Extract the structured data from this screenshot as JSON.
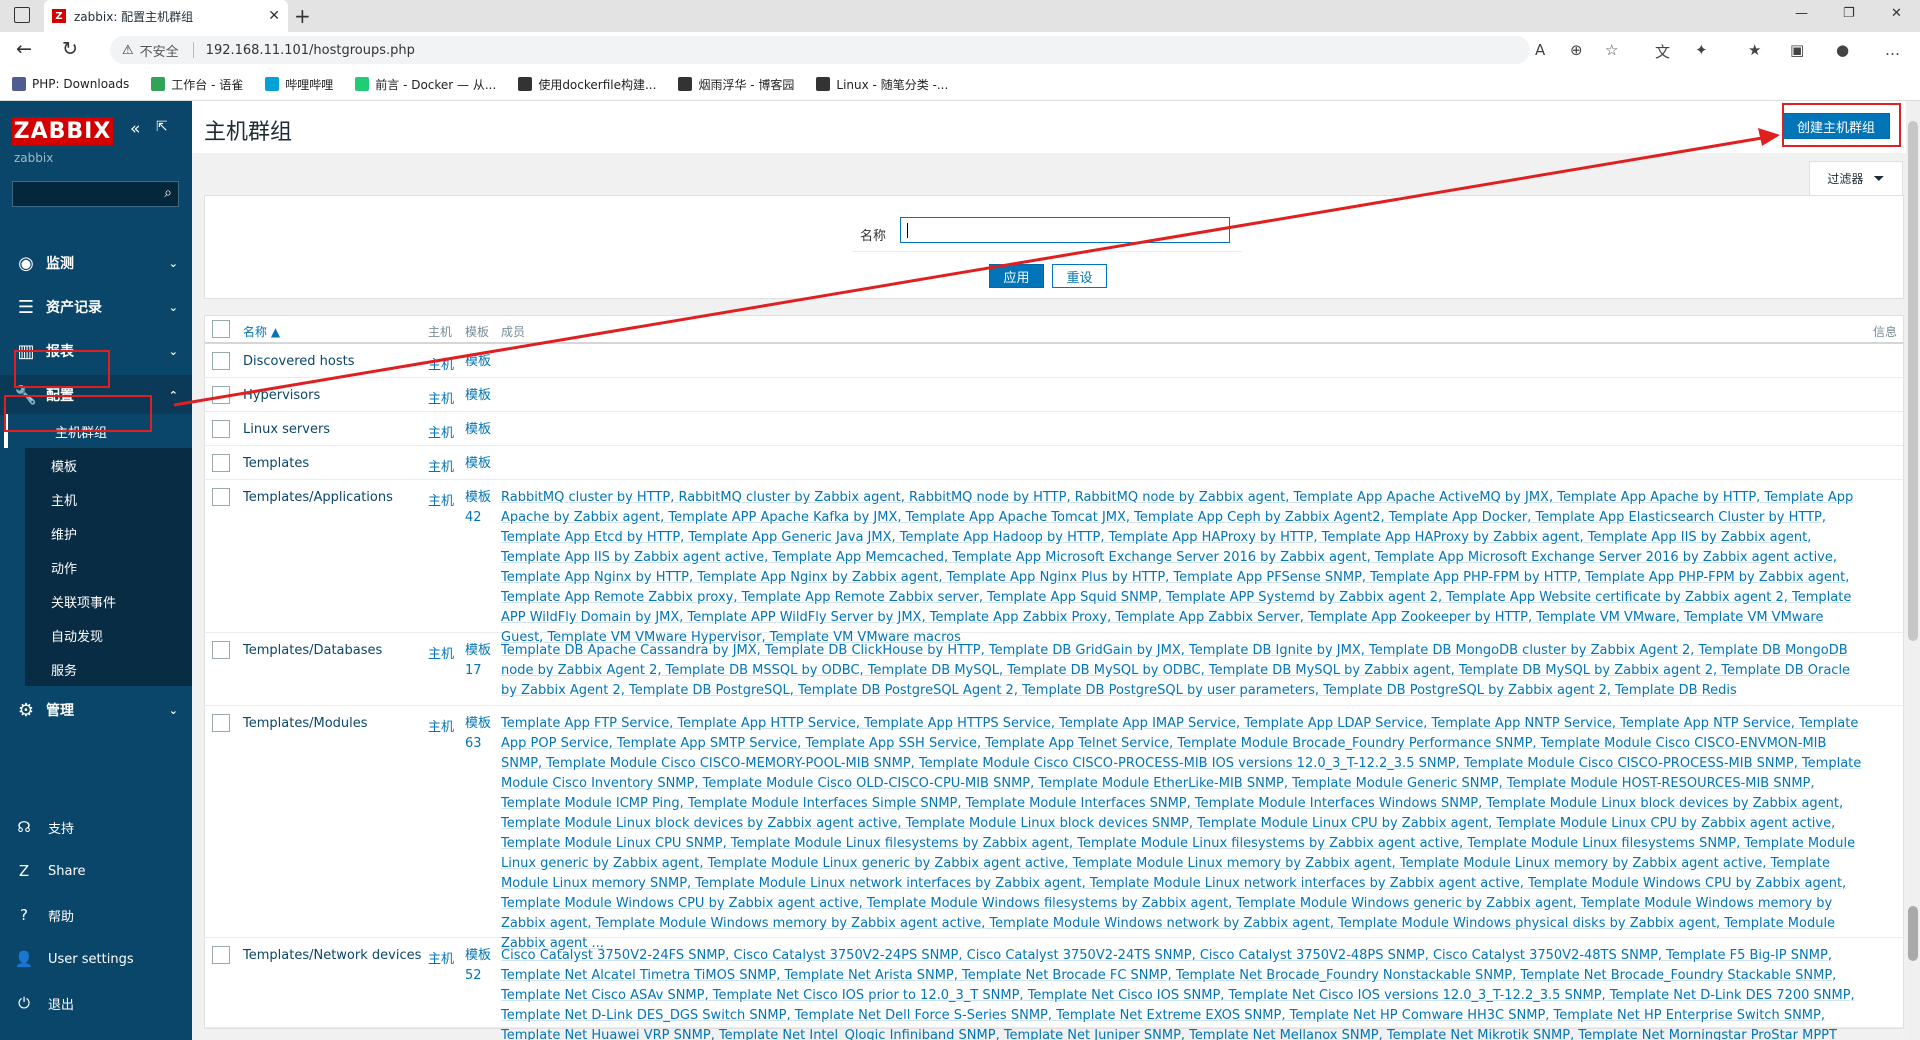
{
  "browser": {
    "tab_title": "zabbix: 配置主机群组",
    "tab_favicon": "Z",
    "url_warning": "不安全",
    "url": "192.168.11.101/hostgroups.php",
    "bookmarks": [
      {
        "label": "PHP: Downloads",
        "icon": "php",
        "color": "#4f5b93"
      },
      {
        "label": "工作台 - 语雀",
        "icon": "yuque",
        "color": "#31a354"
      },
      {
        "label": "哔哩哔哩",
        "icon": "bili",
        "color": "#00a1d6"
      },
      {
        "label": "前言 - Docker — 从...",
        "icon": "docker",
        "color": "#2c7"
      },
      {
        "label": "使用dockerfile构建...",
        "icon": "cnblogs",
        "color": "#333"
      },
      {
        "label": "烟雨浮华 - 博客园",
        "icon": "cnblogs",
        "color": "#333"
      },
      {
        "label": "Linux - 随笔分类 -...",
        "icon": "cnblogs",
        "color": "#333"
      }
    ]
  },
  "sidebar": {
    "logo": "ZABBIX",
    "server_name": "zabbix",
    "menu": [
      {
        "label": "监测",
        "icon": "eye-icon"
      },
      {
        "label": "资产记录",
        "icon": "list-icon"
      },
      {
        "label": "报表",
        "icon": "chart-icon"
      },
      {
        "label": "配置",
        "icon": "wrench-icon"
      },
      {
        "label": "管理",
        "icon": "gear-icon"
      }
    ],
    "config_submenu": [
      "主机群组",
      "模板",
      "主机",
      "维护",
      "动作",
      "关联项事件",
      "自动发现",
      "服务"
    ],
    "bottom": [
      {
        "label": "支持",
        "icon": "headset-icon"
      },
      {
        "label": "Share",
        "icon": "share-icon"
      },
      {
        "label": "帮助",
        "icon": "help-icon"
      },
      {
        "label": "User settings",
        "icon": "user-icon"
      },
      {
        "label": "退出",
        "icon": "power-icon"
      }
    ]
  },
  "page": {
    "title": "主机群组",
    "create_button": "创建主机群组",
    "filter_tab": "过滤器",
    "filter_name_label": "名称",
    "filter_name_value": "",
    "apply_button": "应用",
    "reset_button": "重设"
  },
  "table": {
    "headers": {
      "name": "名称 ▲",
      "hosts": "主机",
      "templates": "模板",
      "members": "成员",
      "info": "信息"
    },
    "rows": [
      {
        "name": "Discovered hosts",
        "hosts": "主机",
        "templates": "模板",
        "members": ""
      },
      {
        "name": "Hypervisors",
        "hosts": "主机",
        "templates": "模板",
        "members": ""
      },
      {
        "name": "Linux servers",
        "hosts": "主机",
        "templates": "模板",
        "members": ""
      },
      {
        "name": "Templates",
        "hosts": "主机",
        "templates": "模板",
        "members": ""
      },
      {
        "name": "Templates/Applications",
        "hosts": "主机",
        "templates": "模板 42",
        "members": "RabbitMQ cluster by HTTP, RabbitMQ cluster by Zabbix agent, RabbitMQ node by HTTP, RabbitMQ node by Zabbix agent, Template App Apache ActiveMQ by JMX, Template App Apache by HTTP, Template App Apache by Zabbix agent, Template APP Apache Kafka by JMX, Template App Apache Tomcat JMX, Template App Ceph by Zabbix Agent2, Template App Docker, Template App Elasticsearch Cluster by HTTP, Template App Etcd by HTTP, Template App Generic Java JMX, Template App Hadoop by HTTP, Template App HAProxy by HTTP, Template App HAProxy by Zabbix agent, Template App IIS by Zabbix agent, Template App IIS by Zabbix agent active, Template App Memcached, Template App Microsoft Exchange Server 2016 by Zabbix agent, Template App Microsoft Exchange Server 2016 by Zabbix agent active, Template App Nginx by HTTP, Template App Nginx by Zabbix agent, Template App Nginx Plus by HTTP, Template App PFSense SNMP, Template App PHP-FPM by HTTP, Template App PHP-FPM by Zabbix agent, Template App Remote Zabbix proxy, Template App Remote Zabbix server, Template App Squid SNMP, Template APP Systemd by Zabbix agent 2, Template App Website certificate by Zabbix agent 2, Template APP WildFly Domain by JMX, Template APP WildFly Server by JMX, Template App Zabbix Proxy, Template App Zabbix Server, Template App Zookeeper by HTTP, Template VM VMware, Template VM VMware Guest, Template VM VMware Hypervisor, Template VM VMware macros"
      },
      {
        "name": "Templates/Databases",
        "hosts": "主机",
        "templates": "模板 17",
        "members": "Template DB Apache Cassandra by JMX, Template DB ClickHouse by HTTP, Template DB GridGain by JMX, Template DB Ignite by JMX, Template DB MongoDB cluster by Zabbix Agent 2, Template DB MongoDB node by Zabbix Agent 2, Template DB MSSQL by ODBC, Template DB MySQL, Template DB MySQL by ODBC, Template DB MySQL by Zabbix agent, Template DB MySQL by Zabbix agent 2, Template DB Oracle by Zabbix Agent 2, Template DB PostgreSQL, Template DB PostgreSQL Agent 2, Template DB PostgreSQL by user parameters, Template DB PostgreSQL by Zabbix agent 2, Template DB Redis"
      },
      {
        "name": "Templates/Modules",
        "hosts": "主机",
        "templates": "模板 63",
        "members": "Template App FTP Service, Template App HTTP Service, Template App HTTPS Service, Template App IMAP Service, Template App LDAP Service, Template App NNTP Service, Template App NTP Service, Template App POP Service, Template App SMTP Service, Template App SSH Service, Template App Telnet Service, Template Module Brocade_Foundry Performance SNMP, Template Module Cisco CISCO-ENVMON-MIB SNMP, Template Module Cisco CISCO-MEMORY-POOL-MIB SNMP, Template Module Cisco CISCO-PROCESS-MIB IOS versions 12.0_3_T-12.2_3.5 SNMP, Template Module Cisco CISCO-PROCESS-MIB SNMP, Template Module Cisco Inventory SNMP, Template Module Cisco OLD-CISCO-CPU-MIB SNMP, Template Module EtherLike-MIB SNMP, Template Module Generic SNMP, Template Module HOST-RESOURCES-MIB SNMP, Template Module ICMP Ping, Template Module Interfaces Simple SNMP, Template Module Interfaces SNMP, Template Module Interfaces Windows SNMP, Template Module Linux block devices by Zabbix agent, Template Module Linux block devices by Zabbix agent active, Template Module Linux block devices SNMP, Template Module Linux CPU by Zabbix agent, Template Module Linux CPU by Zabbix agent active, Template Module Linux CPU SNMP, Template Module Linux filesystems by Zabbix agent, Template Module Linux filesystems by Zabbix agent active, Template Module Linux filesystems SNMP, Template Module Linux generic by Zabbix agent, Template Module Linux generic by Zabbix agent active, Template Module Linux memory by Zabbix agent, Template Module Linux memory by Zabbix agent active, Template Module Linux memory SNMP, Template Module Linux network interfaces by Zabbix agent, Template Module Linux network interfaces by Zabbix agent active, Template Module Windows CPU by Zabbix agent, Template Module Windows CPU by Zabbix agent active, Template Module Windows filesystems by Zabbix agent, Template Module Windows generic by Zabbix agent, Template Module Windows memory by Zabbix agent, Template Module Windows memory by Zabbix agent active, Template Module Windows network by Zabbix agent, Template Module Windows physical disks by Zabbix agent, Template Module Zabbix agent ..."
      },
      {
        "name": "Templates/Network devices",
        "hosts": "主机",
        "templates": "模板 52",
        "members": "Cisco Catalyst 3750V2-24FS SNMP, Cisco Catalyst 3750V2-24PS SNMP, Cisco Catalyst 3750V2-24TS SNMP, Cisco Catalyst 3750V2-48PS SNMP, Cisco Catalyst 3750V2-48TS SNMP, Template F5 Big-IP SNMP, Template Net Alcatel Timetra TiMOS SNMP, Template Net Arista SNMP, Template Net Brocade FC SNMP, Template Net Brocade_Foundry Nonstackable SNMP, Template Net Brocade_Foundry Stackable SNMP, Template Net Cisco ASAv SNMP, Template Net Cisco IOS prior to 12.0_3_T SNMP, Template Net Cisco IOS SNMP, Template Net Cisco IOS versions 12.0_3_T-12.2_3.5 SNMP, Template Net D-Link DES 7200 SNMP, Template Net D-Link DES_DGS Switch SNMP, Template Net Dell Force S-Series SNMP, Template Net Extreme EXOS SNMP, Template Net HP Comware HH3C SNMP, Template Net HP Enterprise Switch SNMP, Template Net Huawei VRP SNMP, Template Net Intel_Qlogic Infiniband SNMP, Template Net Juniper SNMP, Template Net Mellanox SNMP, Template Net Mikrotik SNMP, Template Net Morningstar ProStar MPPT SNMP, Template Net Morningstar ProStar PWM SNMP, Template Net"
      }
    ]
  },
  "colors": {
    "accent": "#0275b8",
    "sidebar": "#0a466a",
    "annotation": "#e02020",
    "logo": "#d40000"
  }
}
